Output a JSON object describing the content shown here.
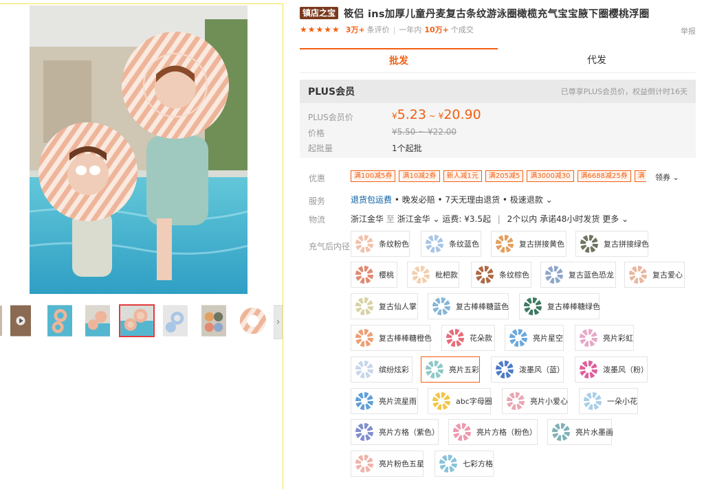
{
  "product": {
    "shop_badge": "镇店之宝",
    "title": "筱侣 ins加厚儿童丹麦复古条纹游泳圈橄榄充气宝宝腋下圈樱桃浮圈",
    "stars": "★★★★★",
    "review_count": "3万+",
    "review_label": "条评价",
    "period": "一年内",
    "sold_count": "10万+",
    "sold_label": "个成交",
    "report": "举报"
  },
  "tabs": [
    "批发",
    "代发"
  ],
  "plus": {
    "header": "PLUS会员",
    "note": "已尊享PLUS会员价，权益倒计时16天",
    "rows": {
      "plus_label": "PLUS会员价",
      "price_label": "价格",
      "min_label": "起批量"
    },
    "currency": "¥",
    "plus_price_low": "5.23",
    "tilde": "~",
    "plus_price_high": "20.90",
    "orig_price": "¥5.50 ~ ¥22.00",
    "min_qty": "1个起批"
  },
  "offers": {
    "label": "优惠",
    "coupons": [
      "满100减5券",
      "满10减2券",
      "新人减1元",
      "满205减5",
      "满3000减30",
      "满6688减25券",
      "满"
    ],
    "get": "领券 ⌄"
  },
  "service": {
    "label": "服务",
    "link": "退货包运费",
    "rest": " • 晚发必赔 • 7天无理由退货 • 极速退款 ⌄"
  },
  "logistics": {
    "label": "物流",
    "from": "浙江金华",
    "to_word": "至",
    "to": "浙江金华 ⌄",
    "fee": "运费: ¥3.5起",
    "promise": "2个以内 承诺48小时发货",
    "more": "更多 ⌄"
  },
  "options": {
    "label": "充气后内径",
    "items": [
      {
        "label": "条纹粉色",
        "color": "#f2c2ad"
      },
      {
        "label": "条纹蓝色",
        "color": "#a9c6e6"
      },
      {
        "label": "复古拼接黄色",
        "color": "#e3a060"
      },
      {
        "label": "复古拼接绿色",
        "color": "#6e7560"
      },
      {
        "label": "樱桃",
        "color": "#e38a70"
      },
      {
        "label": "枇杷款",
        "color": "#f1d0b0"
      },
      {
        "label": "条纹棕色",
        "color": "#b06a45"
      },
      {
        "label": "复古蓝色恐龙",
        "color": "#8fa7c9"
      },
      {
        "label": "复古爱心",
        "color": "#e9b8a0"
      },
      {
        "label": "复古仙人掌",
        "color": "#d8d2a6"
      },
      {
        "label": "复古棒棒糖蓝色",
        "color": "#86b6d8"
      },
      {
        "label": "复古棒棒糖绿色",
        "color": "#3e7a62"
      },
      {
        "label": "复古棒棒糖橙色",
        "color": "#ee9f74"
      },
      {
        "label": "花朵款",
        "color": "#e86c7a"
      },
      {
        "label": "亮片星空",
        "color": "#6aa9e0"
      },
      {
        "label": "亮片彩虹",
        "color": "#e7a9c8"
      },
      {
        "label": "缤纷炫彩",
        "color": "#c9d6ea"
      },
      {
        "label": "亮片五彩",
        "color": "#8fc9c7"
      },
      {
        "label": "泼墨风（蓝）",
        "color": "#4f7cc8"
      },
      {
        "label": "泼墨风（粉）",
        "color": "#e0609a"
      },
      {
        "label": "亮片流星雨",
        "color": "#5fa0d8"
      },
      {
        "label": "abc字母圈",
        "color": "#f3c64a"
      },
      {
        "label": "亮片小爱心",
        "color": "#e9a8b4"
      },
      {
        "label": "一朵小花",
        "color": "#a9cfe6"
      },
      {
        "label": "亮片方格（紫色）",
        "color": "#7f8fcf"
      },
      {
        "label": "亮片方格（粉色）",
        "color": "#ec9ab0"
      },
      {
        "label": "亮片水墨画",
        "color": "#7fb2b8"
      },
      {
        "label": "亮片粉色五星",
        "color": "#f0b3a9"
      },
      {
        "label": "七彩方格",
        "color": "#88c3d9"
      }
    ]
  }
}
